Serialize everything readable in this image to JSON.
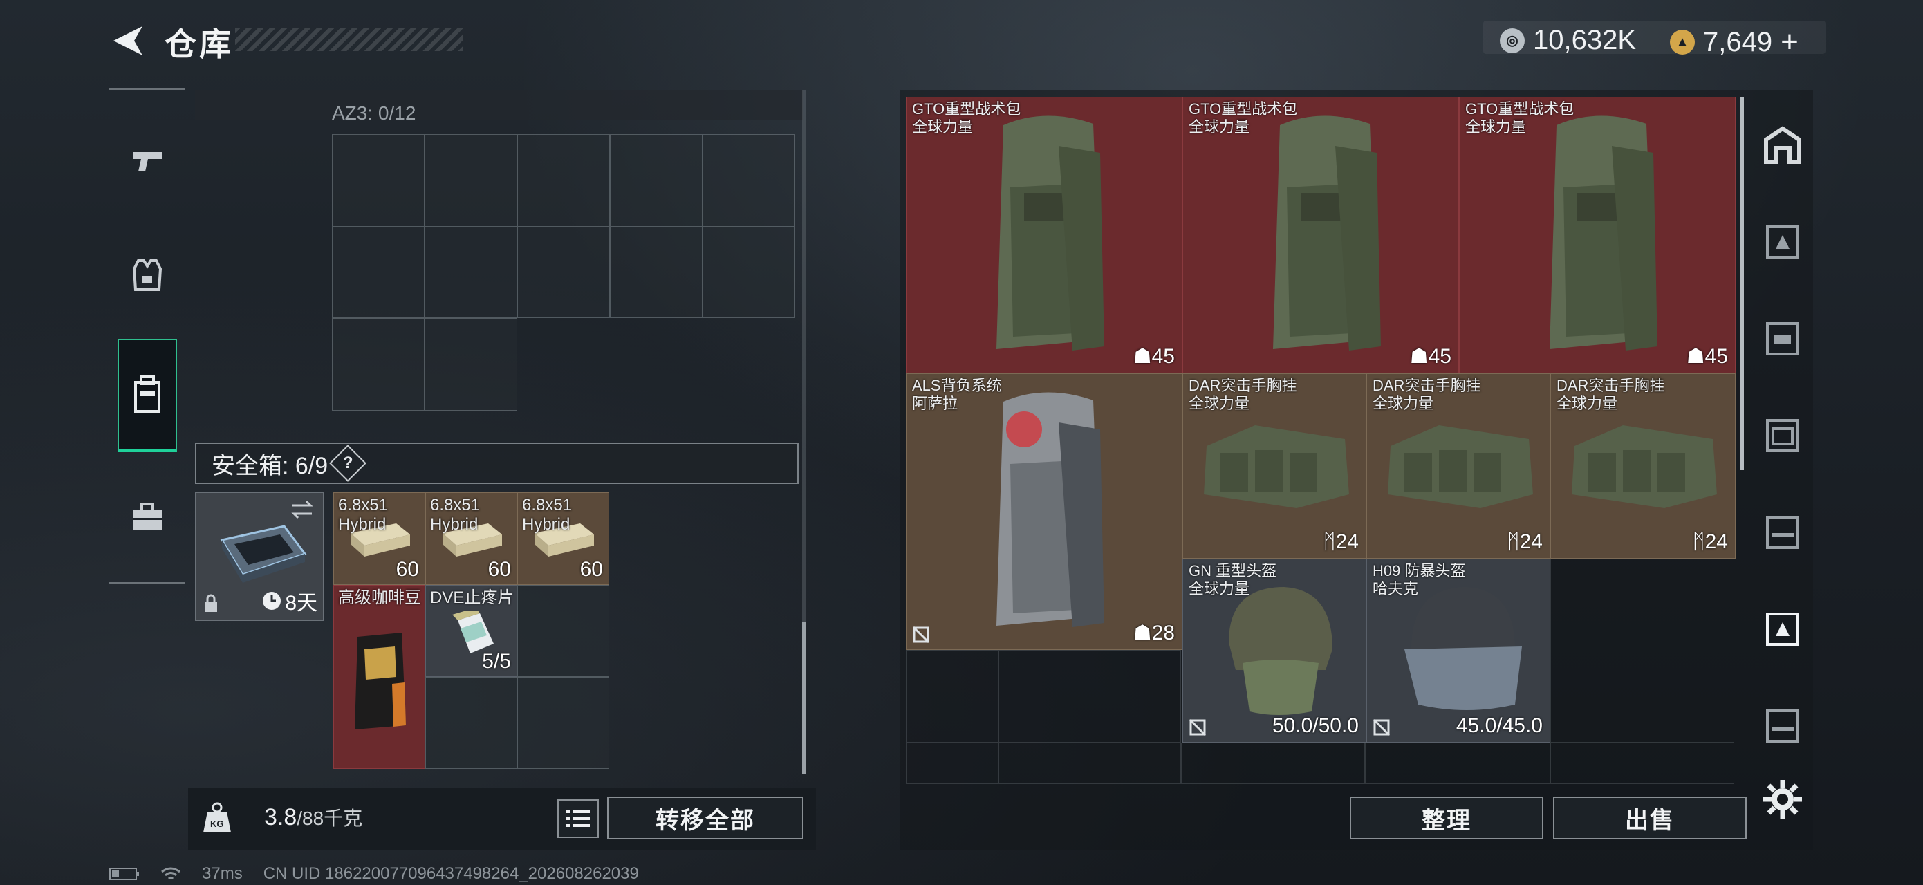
{
  "header": {
    "title": "仓库",
    "back_icon": "back-arrow-icon"
  },
  "currency": {
    "silver": {
      "icon": "silver-coin-icon",
      "value": "10,632K"
    },
    "gold": {
      "icon": "gold-coin-icon",
      "value": "7,649",
      "add": "+"
    }
  },
  "categories": [
    {
      "name": "weapons",
      "icon": "pistol-icon",
      "active": false
    },
    {
      "name": "armor",
      "icon": "vest-icon",
      "active": false
    },
    {
      "name": "backpack",
      "icon": "backpack-icon",
      "active": true
    },
    {
      "name": "case",
      "icon": "briefcase-icon",
      "active": false
    }
  ],
  "container": {
    "label": "AZ3: 0/12"
  },
  "safe_box": {
    "label": "安全箱: 6/9",
    "help": "?",
    "case_timer": "8天",
    "items": [
      {
        "name": "6.8x51",
        "sub": "Hybrid",
        "qty": "60"
      },
      {
        "name": "6.8x51",
        "sub": "Hybrid",
        "qty": "60"
      },
      {
        "name": "6.8x51",
        "sub": "Hybrid",
        "qty": "60"
      },
      {
        "name": "高级咖啡豆",
        "sub": "",
        "qty": ""
      },
      {
        "name": "DVE止疼片",
        "sub": "",
        "qty": "5/5"
      }
    ]
  },
  "footer_left": {
    "weight": "3.8",
    "capacity": "/88千克",
    "transfer_all": "转移全部"
  },
  "stash_items": [
    {
      "name": "GTO重型战术包",
      "sub": "全球力量",
      "qty": "45",
      "type": "backpack"
    },
    {
      "name": "GTO重型战术包",
      "sub": "全球力量",
      "qty": "45",
      "type": "backpack"
    },
    {
      "name": "GTO重型战术包",
      "sub": "全球力量",
      "qty": "45",
      "type": "backpack"
    },
    {
      "name": "ALS背负系统",
      "sub": "阿萨拉",
      "qty": "28",
      "type": "backpack"
    },
    {
      "name": "DAR突击手胸挂",
      "sub": "全球力量",
      "qty": "24",
      "type": "rig"
    },
    {
      "name": "DAR突击手胸挂",
      "sub": "全球力量",
      "qty": "24",
      "type": "rig"
    },
    {
      "name": "DAR突击手胸挂",
      "sub": "全球力量",
      "qty": "24",
      "type": "rig"
    },
    {
      "name": "GN 重型头盔",
      "sub": "全球力量",
      "qty": "50.0/50.0",
      "type": "helmet"
    },
    {
      "name": "H09 防暴头盔",
      "sub": "哈夫克",
      "qty": "45.0/45.0",
      "type": "helmet"
    }
  ],
  "footer_right": {
    "organize": "整理",
    "sell": "出售"
  },
  "status_bar": {
    "ping": "37ms",
    "uid": "CN UID 18622007709643749826​4_202608262039"
  },
  "colors": {
    "accent": "#1fd19a",
    "red_item": "#6b2a2d",
    "tan_item": "#5b4a3a"
  }
}
